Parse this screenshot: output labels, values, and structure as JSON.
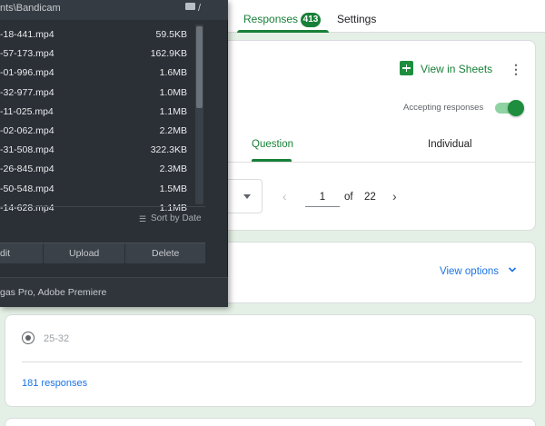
{
  "header": {
    "tabs": [
      {
        "label": "Responses",
        "badge": "413"
      },
      {
        "label": "Settings"
      }
    ]
  },
  "summary_card": {
    "view_in_sheets": "View in Sheets",
    "accepting_label": "Accepting responses",
    "accepting_on": true,
    "subtabs": [
      "Question",
      "Individual"
    ],
    "pagination": {
      "current": "1",
      "of_label": "of",
      "total": "22"
    }
  },
  "view_options_card": {
    "label": "View options"
  },
  "question_card": {
    "option_label": "25-32",
    "responses_label": "181 responses"
  },
  "file_manager": {
    "path": "nts\\Bandicam",
    "path_suffix": "/",
    "files": [
      {
        "name": "-18-441.mp4",
        "size": "59.5KB"
      },
      {
        "name": "-57-173.mp4",
        "size": "162.9KB"
      },
      {
        "name": "-01-996.mp4",
        "size": "1.6MB"
      },
      {
        "name": "-32-977.mp4",
        "size": "1.0MB"
      },
      {
        "name": "-11-025.mp4",
        "size": "1.1MB"
      },
      {
        "name": "-02-062.mp4",
        "size": "2.2MB"
      },
      {
        "name": "-31-508.mp4",
        "size": "322.3KB"
      },
      {
        "name": "-26-845.mp4",
        "size": "2.3MB"
      },
      {
        "name": "-50-548.mp4",
        "size": "1.5MB"
      },
      {
        "name": "-14-628.mp4",
        "size": "1.1MB"
      }
    ],
    "sort_label": "Sort by Date",
    "buttons": [
      "dit",
      "Upload",
      "Delete"
    ],
    "footer": "gas Pro, Adobe Premiere"
  },
  "colors": {
    "accent_green": "#188038",
    "link_blue": "#1a73e8",
    "panel_dark": "#2b3036"
  },
  "icons": [
    "sheets-icon",
    "more-vert-icon",
    "chevron-left-icon",
    "chevron-right-icon",
    "chevron-down-icon",
    "folder-icon",
    "sort-icon"
  ]
}
